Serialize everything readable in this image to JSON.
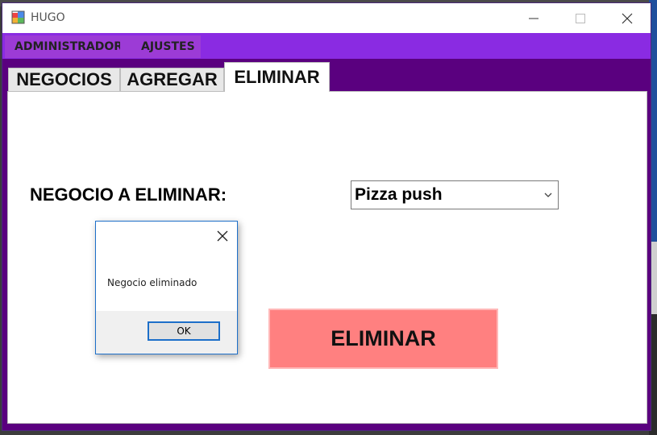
{
  "window": {
    "title": "HUGO"
  },
  "menu": {
    "items": [
      {
        "label": "ADMINISTRADOR"
      },
      {
        "label": "AJUSTES"
      }
    ]
  },
  "tabs": [
    {
      "label": "NEGOCIOS"
    },
    {
      "label": "AGREGAR"
    },
    {
      "label": "ELIMINAR",
      "active": true
    }
  ],
  "form": {
    "label": "NEGOCIO A ELIMINAR:",
    "selected_business": "Pizza push",
    "delete_button": "ELIMINAR"
  },
  "dialog": {
    "message": "Negocio eliminado",
    "ok_label": "OK"
  },
  "colors": {
    "menubar": "#8a2be2",
    "window_bg": "#5a007f",
    "delete_button": "#ff8080",
    "dialog_border": "#1d6fc9"
  }
}
